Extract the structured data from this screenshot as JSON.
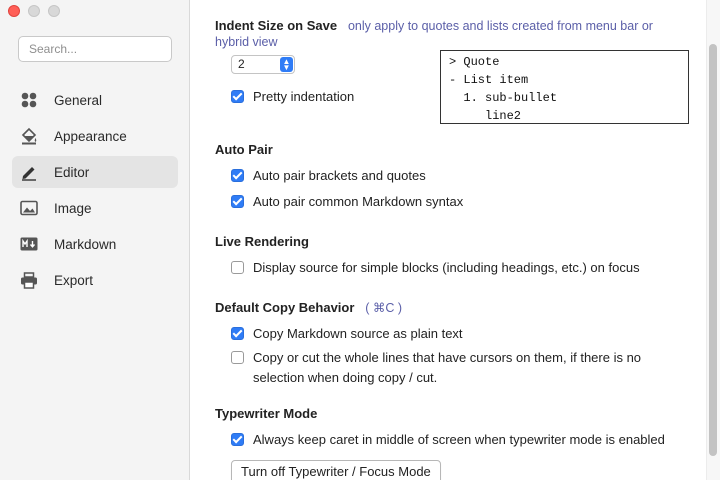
{
  "window": {
    "controls": [
      "close",
      "minimize",
      "zoom"
    ]
  },
  "sidebar": {
    "search_placeholder": "Search...",
    "items": [
      {
        "label": "General",
        "icon": "grid-icon",
        "active": false
      },
      {
        "label": "Appearance",
        "icon": "paint-bucket-icon",
        "active": false
      },
      {
        "label": "Editor",
        "icon": "pencil-icon",
        "active": true
      },
      {
        "label": "Image",
        "icon": "image-icon",
        "active": false
      },
      {
        "label": "Markdown",
        "icon": "markdown-icon",
        "active": false
      },
      {
        "label": "Export",
        "icon": "printer-icon",
        "active": false
      }
    ]
  },
  "indent": {
    "title": "Indent Size on Save",
    "hint": "only apply to quotes and lists created from menu bar or hybrid view",
    "size_value": "2",
    "pretty_label": "Pretty indentation",
    "pretty_checked": true,
    "preview_lines": [
      "> Quote",
      "- List item",
      "  1. sub-bullet",
      "     line2"
    ]
  },
  "auto_pair": {
    "title": "Auto Pair",
    "options": [
      {
        "label": "Auto pair brackets and quotes",
        "checked": true
      },
      {
        "label": "Auto pair common Markdown syntax",
        "checked": true
      }
    ]
  },
  "live_rendering": {
    "title": "Live Rendering",
    "options": [
      {
        "label": "Display source for simple blocks (including headings, etc.) on focus",
        "checked": false
      }
    ]
  },
  "copy_behavior": {
    "title": "Default Copy Behavior",
    "shortcut": "( ⌘C )",
    "options": [
      {
        "label": "Copy Markdown source as plain text",
        "checked": true
      },
      {
        "label": "Copy or cut the whole lines that have cursors on them, if there is no selection when doing copy / cut.",
        "checked": false
      }
    ]
  },
  "typewriter": {
    "title": "Typewriter Mode",
    "options": [
      {
        "label": "Always keep caret in middle of screen when typewriter mode is enabled",
        "checked": true
      }
    ],
    "button_label": "Turn off Typewriter / Focus Mode"
  },
  "colors": {
    "accent": "#2f7cf6",
    "hint_text": "#5b5fa8",
    "sidebar_bg": "#f4f4f4",
    "active_item_bg": "#e4e4e4"
  }
}
